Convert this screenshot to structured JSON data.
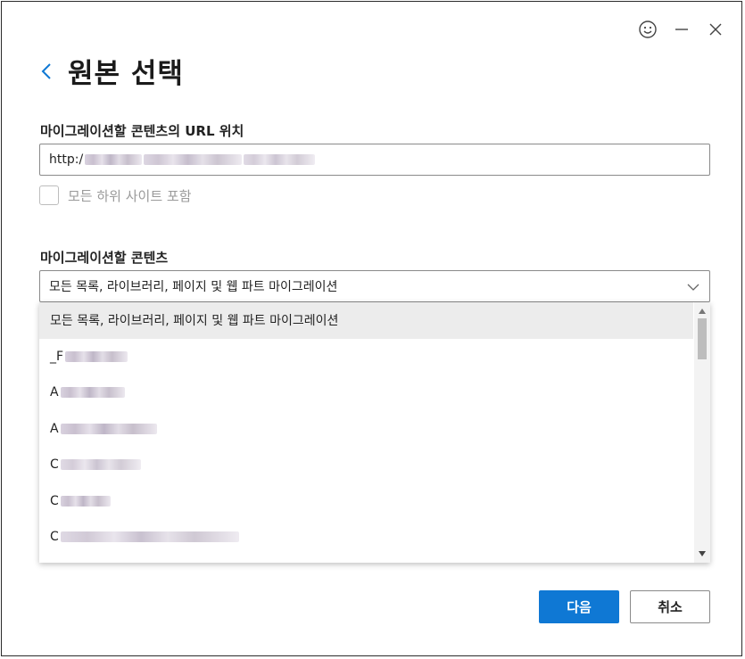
{
  "window": {
    "icons": {
      "feedback": "smiley-icon",
      "minimize": "minimize-icon",
      "close": "close-icon"
    }
  },
  "header": {
    "back_icon": "chevron-left-icon",
    "title": "원본 선택"
  },
  "url_section": {
    "label": "마이그레이션할 콘텐츠의 URL 위치",
    "value_prefix": "http:/",
    "value_obscured": true
  },
  "include_subsites": {
    "label": "모든 하위 사이트 포함",
    "checked": false
  },
  "content_section": {
    "label": "마이그레이션할 콘텐츠",
    "selected": "모든 목록, 라이브러리, 페이지 및 웹 파트 마이그레이션",
    "options": [
      {
        "prefix": "모든 목록, 라이브러리, 페이지 및 웹 파트 마이그레이션",
        "obscured": false
      },
      {
        "prefix": "_F",
        "obscured": true
      },
      {
        "prefix": "A",
        "obscured": true
      },
      {
        "prefix": "A",
        "obscured": true
      },
      {
        "prefix": "C",
        "obscured": true
      },
      {
        "prefix": "C",
        "obscured": true
      },
      {
        "prefix": "C",
        "obscured": true
      }
    ]
  },
  "buttons": {
    "next": "다음",
    "cancel": "취소"
  },
  "colors": {
    "accent": "#0f78d4",
    "border": "#8a8a8a",
    "selected_row": "#ececec"
  }
}
